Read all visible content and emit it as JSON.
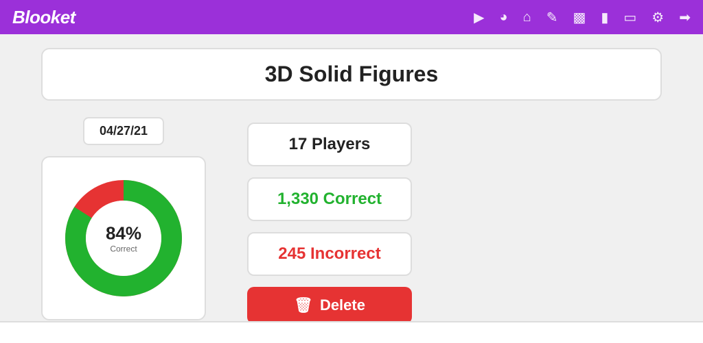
{
  "nav": {
    "logo": "Blooket",
    "icons": [
      {
        "name": "play-icon",
        "symbol": "▶"
      },
      {
        "name": "explore-icon",
        "symbol": "🧭"
      },
      {
        "name": "home-icon",
        "symbol": "🏠"
      },
      {
        "name": "edit-icon",
        "symbol": "✏️"
      },
      {
        "name": "stats-icon",
        "symbol": "📊"
      },
      {
        "name": "store-icon",
        "symbol": "🏪"
      },
      {
        "name": "book-icon",
        "symbol": "📚"
      },
      {
        "name": "settings-icon",
        "symbol": "⚙️"
      },
      {
        "name": "logout-icon",
        "symbol": "➡️"
      }
    ]
  },
  "title": "3D Solid Figures",
  "date": "04/27/21",
  "chart": {
    "correct_pct": 84,
    "incorrect_pct": 16,
    "label_percent": "84%",
    "label_text": "Correct"
  },
  "stats": {
    "players_label": "17 Players",
    "correct_label": "1,330 Correct",
    "incorrect_label": "245 Incorrect"
  },
  "delete_button": "Delete",
  "colors": {
    "green": "#22b22f",
    "red": "#e63333",
    "purple": "#9b30d9"
  }
}
